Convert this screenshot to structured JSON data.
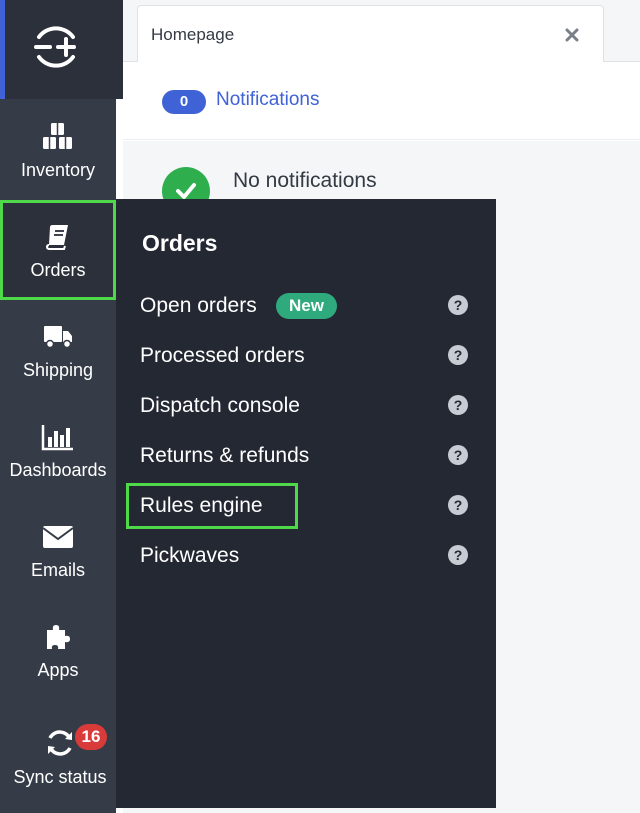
{
  "tab": {
    "label": "Homepage"
  },
  "notifications": {
    "count": "0",
    "link_label": "Notifications",
    "empty_message": "No notifications"
  },
  "sidebar": {
    "items": [
      {
        "label": "Inventory",
        "icon": "cubes-icon"
      },
      {
        "label": "Orders",
        "icon": "book-icon"
      },
      {
        "label": "Shipping",
        "icon": "truck-icon"
      },
      {
        "label": "Dashboards",
        "icon": "bar-chart-icon"
      },
      {
        "label": "Emails",
        "icon": "envelope-icon"
      },
      {
        "label": "Apps",
        "icon": "puzzle-icon"
      },
      {
        "label": "Sync status",
        "icon": "sync-icon",
        "badge": "16"
      }
    ]
  },
  "flyout": {
    "title": "Orders",
    "items": [
      {
        "label": "Open orders",
        "badge": "New",
        "help": "?"
      },
      {
        "label": "Processed orders",
        "help": "?"
      },
      {
        "label": "Dispatch console",
        "help": "?"
      },
      {
        "label": "Returns & refunds",
        "help": "?"
      },
      {
        "label": "Rules engine",
        "help": "?"
      },
      {
        "label": "Pickwaves",
        "help": "?"
      }
    ]
  },
  "colors": {
    "accent": "#3f62d6",
    "highlight": "#4fd94a",
    "sidebar": "#353c47",
    "flyout": "#232833",
    "success": "#2fae4e",
    "new_badge": "#2faa7d",
    "alert_badge": "#d93a3a"
  }
}
